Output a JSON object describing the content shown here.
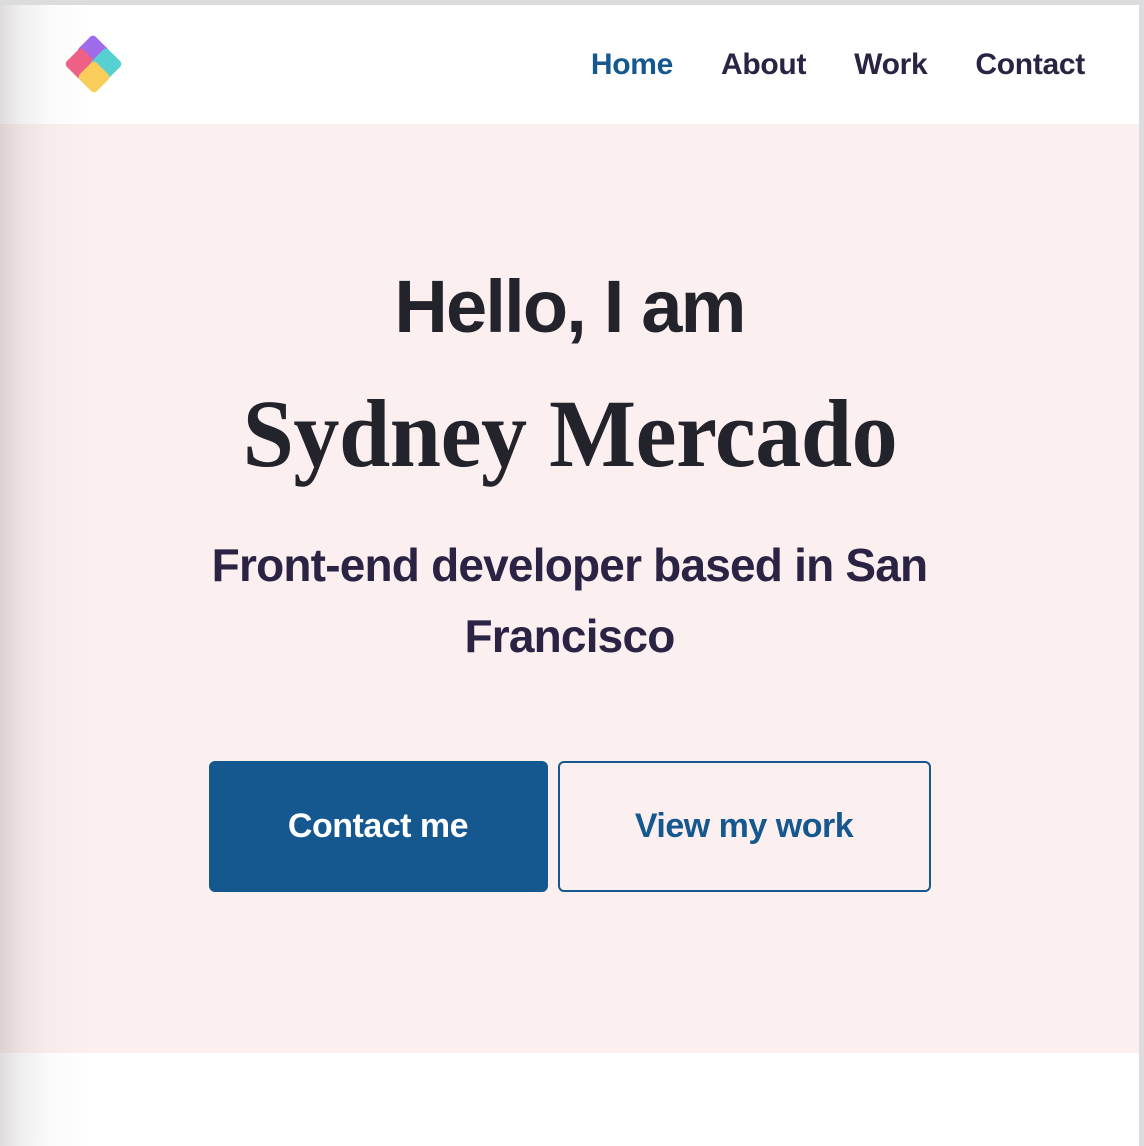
{
  "header": {
    "logo": {
      "name": "brand-logo",
      "shapes": [
        {
          "id": "purple",
          "color": "#a06bea"
        },
        {
          "id": "pink",
          "color": "#ef5f85"
        },
        {
          "id": "teal",
          "color": "#56d0d0"
        },
        {
          "id": "yellow",
          "color": "#f8cd5a"
        }
      ]
    },
    "nav": {
      "items": [
        {
          "label": "Home",
          "active": true
        },
        {
          "label": "About",
          "active": false
        },
        {
          "label": "Work",
          "active": false
        },
        {
          "label": "Contact",
          "active": false
        }
      ]
    }
  },
  "hero": {
    "greeting": "Hello, I am",
    "name": "Sydney Mercado",
    "subtitle": "Front-end developer based in San Francisco",
    "primary_button": "Contact me",
    "secondary_button": "View my work"
  },
  "colors": {
    "accent_blue": "#15578f",
    "hero_background": "#fcefef",
    "heading_dark": "#23232b",
    "nav_text": "#2b2344",
    "page_background": "#ffffff",
    "chrome_strip": "#dcdcde"
  }
}
